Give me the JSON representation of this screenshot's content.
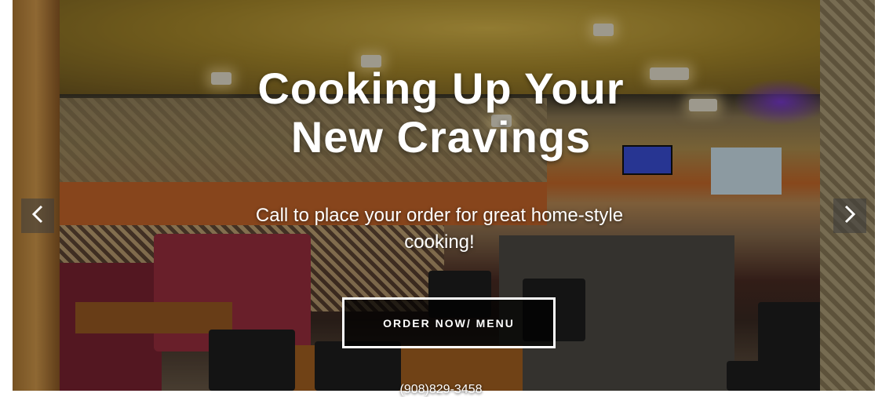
{
  "hero": {
    "headline": [
      "Cooking Up Your",
      "New Cravings"
    ],
    "subtext": "Call to place your order for great home-style cooking!",
    "cta_label": "ORDER NOW/ MENU",
    "phone": "(908)829-3458"
  },
  "carousel": {
    "prev_icon": "chevron-left-icon",
    "next_icon": "chevron-right-icon"
  },
  "colors": {
    "text": "#ffffff",
    "cta_border": "#ffffff",
    "cta_background": "#000000"
  }
}
